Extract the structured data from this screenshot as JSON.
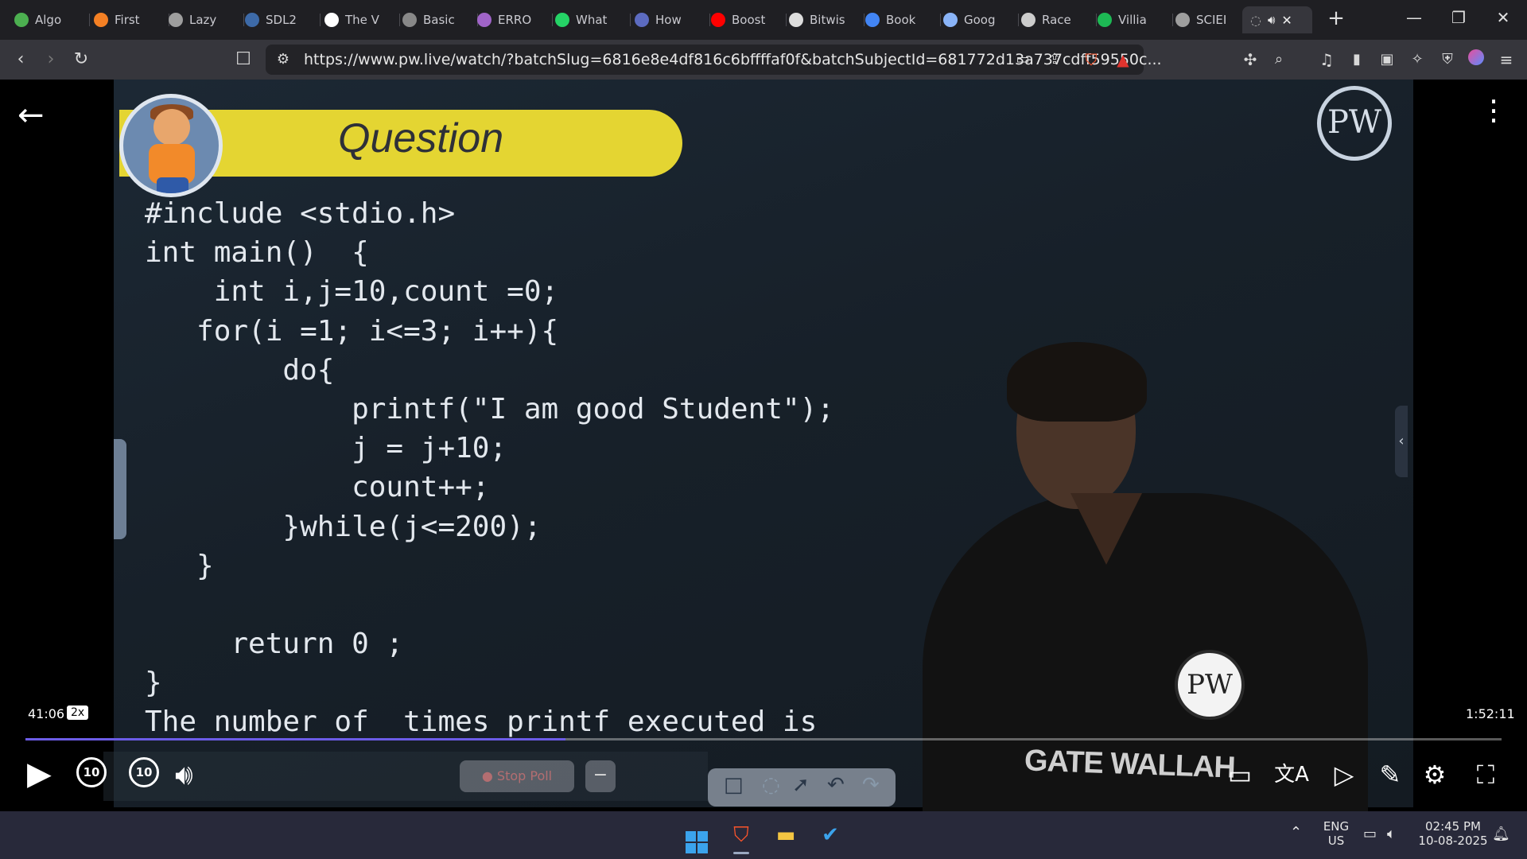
{
  "browser": {
    "tabs": [
      {
        "label": "Algo",
        "icon": "algo-icon",
        "color": "#4caf50"
      },
      {
        "label": "First",
        "icon": "stack-icon",
        "color": "#f48024"
      },
      {
        "label": "Lazy",
        "icon": "globe-icon",
        "color": "#9e9e9e"
      },
      {
        "label": "SDL2",
        "icon": "sdl-icon",
        "color": "#3d6aa8"
      },
      {
        "label": "The V",
        "icon": "w3-icon",
        "color": "#ffffff"
      },
      {
        "label": "Basic",
        "icon": "tag-icon",
        "color": "#888888"
      },
      {
        "label": "ERRO",
        "icon": "brain-icon",
        "color": "#a064c8"
      },
      {
        "label": "What",
        "icon": "whatsapp-icon",
        "color": "#25d366"
      },
      {
        "label": "How",
        "icon": "bookmark-icon",
        "color": "#5c6bc0"
      },
      {
        "label": "Boost",
        "icon": "youtube-icon",
        "color": "#ff0000"
      },
      {
        "label": "Bitwis",
        "icon": "origin-icon",
        "color": "#dddddd"
      },
      {
        "label": "Book",
        "icon": "google-icon",
        "color": "#4285f4"
      },
      {
        "label": "Goog",
        "icon": "gemini-icon",
        "color": "#8ab4f8"
      },
      {
        "label": "Race",
        "icon": "openai-icon",
        "color": "#cccccc"
      },
      {
        "label": "Villia",
        "icon": "spotify-icon",
        "color": "#1db954"
      },
      {
        "label": "SCIEI",
        "icon": "globe-icon",
        "color": "#9e9e9e"
      }
    ],
    "active_tab_icons": [
      "loading-icon",
      "speaker-icon",
      "close-icon"
    ],
    "new_tab": "+",
    "url": "https://www.pw.live/watch/?batchSlug=6816e8e4df816c6bffffaf0f&batchSubjectId=681772d13a737cdff59550c..."
  },
  "video": {
    "banner": "Question",
    "code_lines": [
      "#include <stdio.h>",
      "int main()  {",
      "    int i,j=10,count =0;",
      "   for(i =1; i<=3; i++){",
      "        do{",
      "            printf(\"I am good Student\");",
      "            j = j+10;",
      "            count++;",
      "        }while(j<=200);",
      "   }",
      "",
      "     return 0 ;",
      "}",
      "The number of  times printf executed is"
    ],
    "logo_text": "PW",
    "badge_text": "PW",
    "shirt_text": "GATE WALLAH",
    "chevron": "‹"
  },
  "player": {
    "current_time": "41:06",
    "speed": "2x",
    "total_time": "1:52:11",
    "progress_fraction": 0.366,
    "skip_back": "10",
    "skip_forward": "10",
    "stop_poll": "Stop Poll",
    "minus": "−"
  },
  "taskbar": {
    "lang_top": "ENG",
    "lang_bottom": "US",
    "time": "02:45 PM",
    "date": "10-08-2025"
  }
}
